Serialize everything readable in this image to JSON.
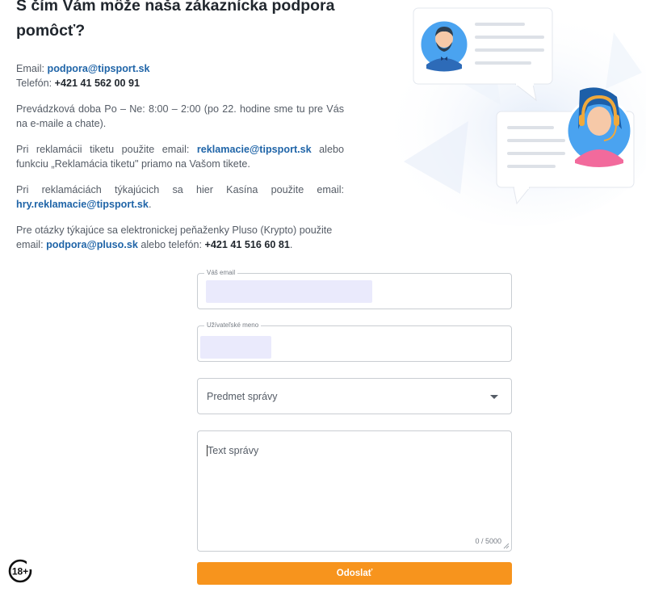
{
  "header": {
    "title": "S čím Vám môže naša zákaznícka podpora pomôcť?"
  },
  "contact": {
    "email_label": "Email: ",
    "email": "podpora@tipsport.sk",
    "phone_label": "Telefón: ",
    "phone": "+421 41 562 00 91",
    "hours": "Prevádzková doba Po – Ne: 8:00 – 2:00 (po 22. hodine sme tu pre Vás na e-maile a chate).",
    "ticket_pre": "Pri reklamácii tiketu použite email: ",
    "ticket_email": "reklamacie@tipsport.sk",
    "ticket_post": " alebo funkciu „Reklamácia tiketu\" priamo na Vašom tikete.",
    "casino_pre": "Pri reklamáciách týkajúcich sa hier Kasína použite email: ",
    "casino_email": "hry.reklamacie@tipsport.sk",
    "casino_post": ".",
    "pluso_pre": "Pre otázky týkajúce sa elektronickej peňaženky Pluso (Krypto) použite email: ",
    "pluso_email": "podpora@pluso.sk",
    "pluso_mid": " alebo telefón: ",
    "pluso_phone": "+421 41 516 60 81",
    "pluso_post": "."
  },
  "form": {
    "email_label": "Váš email",
    "username_label": "Užívateľské meno",
    "subject_placeholder": "Predmet správy",
    "message_placeholder": "Text správy",
    "counter": "0 / 5000",
    "submit_label": "Odoslať"
  },
  "badge": {
    "age": "18+"
  },
  "colors": {
    "accent": "#f7941d",
    "link": "#2065a8",
    "autofill": "#eaeafc"
  }
}
